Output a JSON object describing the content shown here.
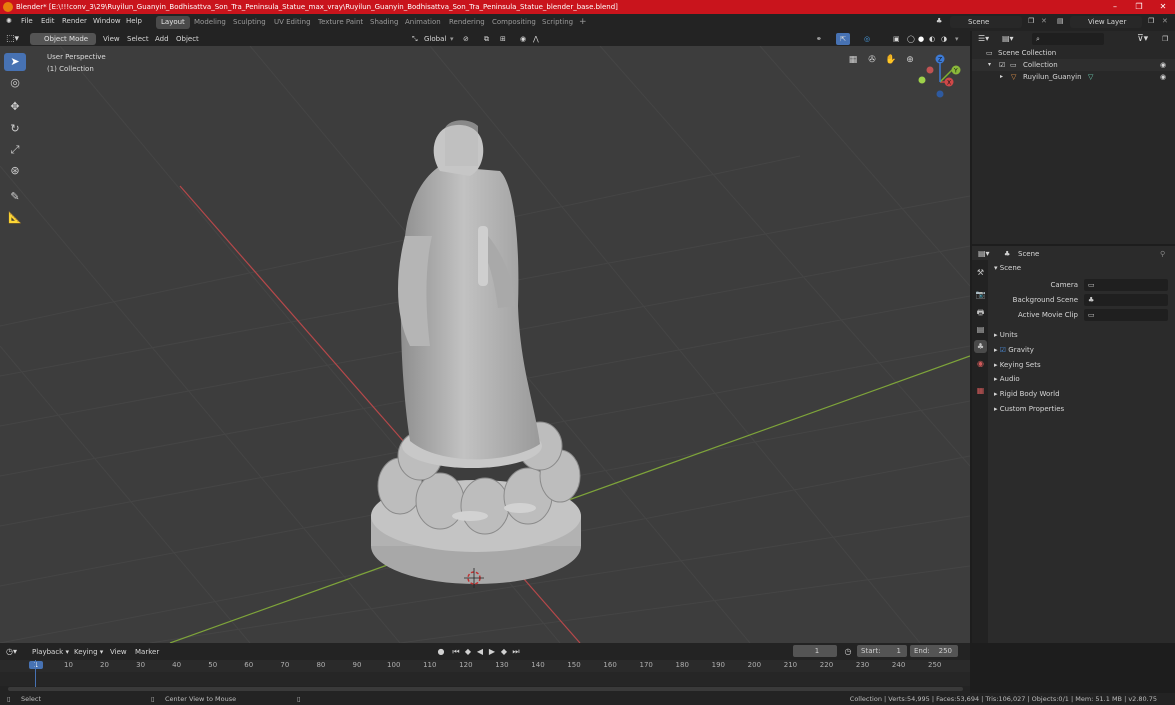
{
  "window": {
    "title": "Blender* [E:\\!!!conv_3\\29\\Ruyilun_Guanyin_Bodhisattva_Son_Tra_Peninsula_Statue_max_vray\\Ruyilun_Guanyin_Bodhisattva_Son_Tra_Peninsula_Statue_blender_base.blend]",
    "minimize": "–",
    "maximize": "❐",
    "close": "✕"
  },
  "menu": {
    "file": "File",
    "edit": "Edit",
    "render": "Render",
    "window": "Window",
    "help": "Help"
  },
  "workspaces": [
    "Layout",
    "Modeling",
    "Sculpting",
    "UV Editing",
    "Texture Paint",
    "Shading",
    "Animation",
    "Rendering",
    "Compositing",
    "Scripting"
  ],
  "workspace_add": "+",
  "scene_field": "Scene",
  "view_layer_field": "View Layer",
  "viewport_header": {
    "mode": "Object Mode",
    "view": "View",
    "select": "Select",
    "add": "Add",
    "object": "Object",
    "orientation": "Global"
  },
  "viewport": {
    "perspective": "User Perspective",
    "collection": "(1) Collection",
    "gizmo_x": "X",
    "gizmo_y": "Y",
    "gizmo_z": "Z"
  },
  "outliner": {
    "scene_collection": "Scene Collection",
    "collection": "Collection",
    "object": "Ruyilun_Guanyin"
  },
  "properties": {
    "context": "Scene",
    "panel": "Scene",
    "camera_label": "Camera",
    "background_scene_label": "Background Scene",
    "active_movie_clip_label": "Active Movie Clip",
    "sections": [
      "Units",
      "Gravity",
      "Keying Sets",
      "Audio",
      "Rigid Body World",
      "Custom Properties"
    ]
  },
  "timeline": {
    "playback": "Playback",
    "keying": "Keying",
    "view": "View",
    "marker": "Marker",
    "current_frame": "1",
    "start_label": "Start:",
    "start": "1",
    "end_label": "End:",
    "end": "250",
    "ticks": [
      "1",
      "10",
      "20",
      "30",
      "40",
      "50",
      "60",
      "70",
      "80",
      "90",
      "100",
      "110",
      "120",
      "130",
      "140",
      "150",
      "160",
      "170",
      "180",
      "190",
      "200",
      "210",
      "220",
      "230",
      "240",
      "250"
    ]
  },
  "status": {
    "select": "Select",
    "center_view": "Center View to Mouse",
    "stats": "Collection | Verts:54,995 | Faces:53,694 | Tris:106,027 | Objects:0/1 | Mem: 51.1 MB | v2.80.75"
  },
  "colors": {
    "title_bar": "#c9141c",
    "accent": "#4772b3",
    "grid_x_axis": "#b5484a",
    "grid_y_axis": "#7ea43a"
  }
}
